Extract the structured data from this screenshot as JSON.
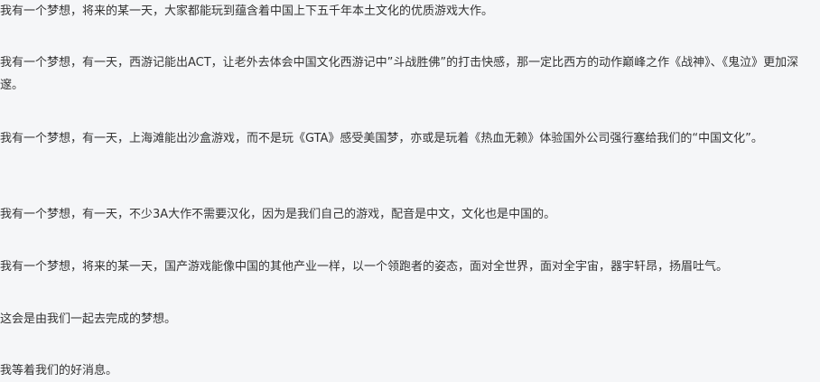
{
  "article": {
    "paragraphs": [
      "我有一个梦想，将来的某一天，大家都能玩到蕴含着中国上下五千年本土文化的优质游戏大作。",
      "我有一个梦想，有一天，西游记能出ACT，让老外去体会中国文化西游记中”斗战胜佛”的打击快感，那一定比西方的动作巅峰之作《战神》、《鬼泣》更加深邃。",
      "我有一个梦想，有一天，上海滩能出沙盒游戏，而不是玩《GTA》感受美国梦，亦或是玩着《热血无赖》体验国外公司强行塞给我们的“中国文化”。",
      "我有一个梦想，有一天，不少3A大作不需要汉化，因为是我们自己的游戏，配音是中文，文化也是中国的。",
      "我有一个梦想，将来的某一天，国产游戏能像中国的其他产业一样，以一个领跑者的姿态，面对全世界，面对全宇宙，器宇轩昂，扬眉吐气。",
      "这会是由我们一起去完成的梦想。",
      "我等着我们的好消息。"
    ]
  }
}
